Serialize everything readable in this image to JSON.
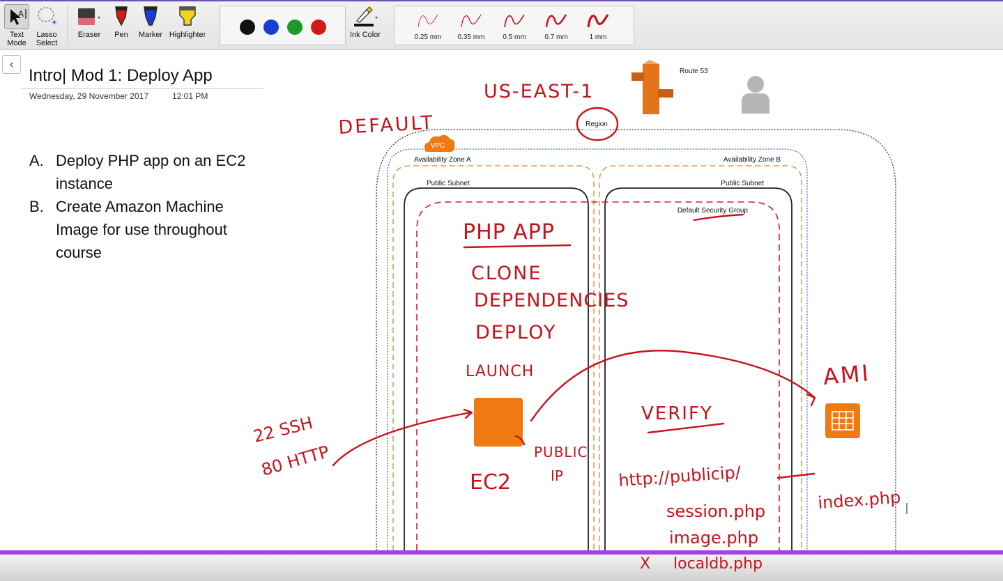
{
  "toolbar": {
    "text_mode": "Text Mode",
    "lasso_select": "Lasso Select",
    "eraser": "Eraser",
    "pen": "Pen",
    "marker": "Marker",
    "highlighter": "Highlighter",
    "ink_color": "Ink Color",
    "colors": [
      "#111111",
      "#1a3fd0",
      "#1a9a2a",
      "#d11a1a"
    ],
    "thickness": [
      "0.25 mm",
      "0.35 mm",
      "0.5 mm",
      "0.7 mm",
      "1 mm"
    ],
    "accent": "#6a4fb3"
  },
  "page": {
    "title": "Intro| Mod 1: Deploy App",
    "date": "Wednesday, 29 November 2017",
    "time": "12:01 PM",
    "items": [
      {
        "marker": "A.",
        "text": "Deploy PHP app on an EC2 instance"
      },
      {
        "marker": "B.",
        "text": "Create Amazon Machine Image for use throughout course"
      }
    ]
  },
  "diagram": {
    "route53": "Route 53",
    "region": "Region",
    "vpc": "VPC",
    "az_a": "Availability Zone A",
    "az_b": "Availability Zone B",
    "subnet_a": "Public Subnet",
    "subnet_b": "Public Subnet",
    "security_group": "Default Security Group"
  },
  "ink": {
    "region_name": "US-EAST-1",
    "default": "DEFAULT",
    "php_app": "PHP APP",
    "clone": "CLONE",
    "dependencies": "DEPENDENCIES",
    "deploy": "DEPLOY",
    "launch": "LAUNCH",
    "ec2": "EC2",
    "public_ip": "PUBLIC",
    "ip": "IP",
    "ssh": "22 SSH",
    "http": "80 HTTP",
    "ami": "AMI",
    "verify": "VERIFY",
    "url": "http://publicip/",
    "session": "session.php",
    "image": "image.php",
    "localdb": "localdb.php",
    "x": "X",
    "index": "index.php"
  },
  "colors": {
    "ink": "#c8121b",
    "aws_orange": "#f07a12",
    "bottom_accent": "#a73ee6"
  }
}
